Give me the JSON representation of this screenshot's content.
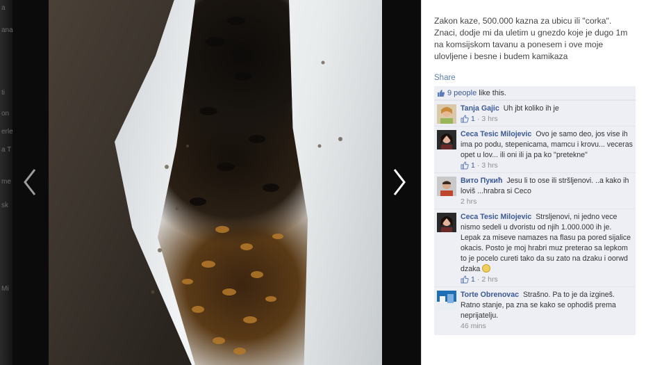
{
  "backdrop": {
    "ghost_fragments": [
      "a",
      "ana",
      "ti",
      "on",
      "erle",
      "a T",
      "me",
      "sk",
      "Mi"
    ]
  },
  "viewer": {
    "prev_icon": "chevron-left-icon",
    "next_icon": "chevron-right-icon"
  },
  "post": {
    "text": "Zakon kaze, 500.000 kazna za ubicu ili \"corka\". Znaci, dodje mi da uletim u gnezdo koje je dugo 1m na komsijskom tavanu a ponesem i ove moje ulovljene i besne i budem kamikaza",
    "share_label": "Share",
    "likes_count": "9 people",
    "likes_suffix": "like this."
  },
  "comments": [
    {
      "author": "Tanja Gajic",
      "text": "Uh jbt koliko ih je",
      "likes": "1",
      "time": "3 hrs"
    },
    {
      "author": "Ceca Tesic Milojevic",
      "text": "Ovo je samo deo, jos vise ih ima po podu, stepenicama, mamcu i krovu... veceras opet u lov... ili oni ili ja pa ko \"pretekne\"",
      "likes": "1",
      "time": "3 hrs"
    },
    {
      "author": "Вито Пукић",
      "text": "Jesu li to ose ili stršljenovi. ..a kako ih loviš ...hrabra si Ceco",
      "likes": "",
      "time": "2 hrs"
    },
    {
      "author": "Ceca Tesic Milojevic",
      "text": "Strsljenovi, ni jedno vece nismo sedeli u dvoristu od njih 1.000.000 ih je. Lepak za miseve namazes na flasu pa pored sijalice okacis. Posto je moj hrabri muz preterao sa lepkom to je pocelo cureti tako da su zato na dzaku i oorwd dzaka",
      "likes": "1",
      "time": "2 hrs"
    },
    {
      "author": "Torte Obrenovac",
      "text": "Strašno. Pa to je da izgineš. Ratno stanje, pa zna se kako se ophodiš prema neprijatelju.",
      "likes": "",
      "time": "46 mins"
    }
  ],
  "colors": {
    "link": "#3b5998",
    "share": "#5b7bb8",
    "comment_bg": "#edeff4"
  }
}
